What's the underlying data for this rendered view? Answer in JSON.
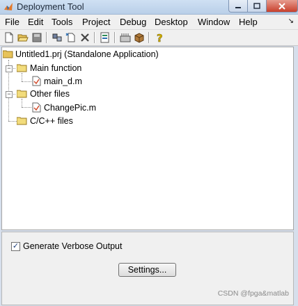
{
  "window": {
    "title": "Deployment Tool"
  },
  "menu": [
    "File",
    "Edit",
    "Tools",
    "Project",
    "Debug",
    "Desktop",
    "Window",
    "Help"
  ],
  "toolbar": {
    "icons": [
      "new-file-icon",
      "open-folder-icon",
      "save-icon",
      "build-icon",
      "new-doc-icon",
      "delete-icon",
      "settings-icon",
      "package-icon",
      "archive-icon",
      "help-icon"
    ]
  },
  "tree": {
    "project": "Untitled1.prj (Standalone Application)",
    "main_function": "Main function",
    "main_file": "main_d.m",
    "other_files": "Other files",
    "other_file": "ChangePic.m",
    "cpp_files": "C/C++ files"
  },
  "options": {
    "verbose_label": "Generate Verbose Output",
    "verbose_checked": true
  },
  "settings_label": "Settings...",
  "watermark": "CSDN @fpga&matlab",
  "colors": {
    "titlebar": "#c4d6ed",
    "folder": "#f2dc7c",
    "close": "#c8402c"
  }
}
